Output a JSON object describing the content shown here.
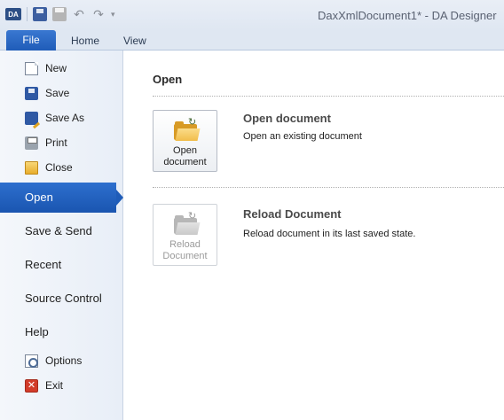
{
  "window": {
    "app_icon_text": "DA",
    "title": "DaxXmlDocument1* - DA Designer"
  },
  "quick_access": {
    "items": [
      "app-icon",
      "save-icon",
      "print-icon",
      "undo-icon",
      "redo-icon",
      "customize-icon"
    ]
  },
  "ribbon": {
    "tabs": [
      {
        "label": "File",
        "active": true
      },
      {
        "label": "Home",
        "active": false
      },
      {
        "label": "View",
        "active": false
      }
    ]
  },
  "backstage": {
    "commands_top": [
      {
        "label": "New",
        "icon": "new-document-icon"
      },
      {
        "label": "Save",
        "icon": "save-icon"
      },
      {
        "label": "Save As",
        "icon": "save-as-icon"
      },
      {
        "label": "Print",
        "icon": "print-icon"
      },
      {
        "label": "Close",
        "icon": "close-folder-icon"
      }
    ],
    "pages": [
      {
        "label": "Open",
        "active": true
      },
      {
        "label": "Save & Send",
        "active": false
      },
      {
        "label": "Recent",
        "active": false
      },
      {
        "label": "Source Control",
        "active": false
      },
      {
        "label": "Help",
        "active": false
      }
    ],
    "commands_bottom": [
      {
        "label": "Options",
        "icon": "options-icon"
      },
      {
        "label": "Exit",
        "icon": "exit-icon",
        "glyph": "✕"
      }
    ]
  },
  "open_page": {
    "heading": "Open",
    "items": [
      {
        "button_label": "Open\ndocument",
        "title": "Open document",
        "description": "Open an existing document",
        "enabled": true
      },
      {
        "button_label": "Reload\nDocument",
        "title": "Reload Document",
        "description": "Reload document in its last saved state.",
        "enabled": false
      }
    ]
  },
  "colors": {
    "accent": "#1f5cb8",
    "titlebar": "#dfe7f2",
    "nav_bg": "#eef3f9"
  }
}
